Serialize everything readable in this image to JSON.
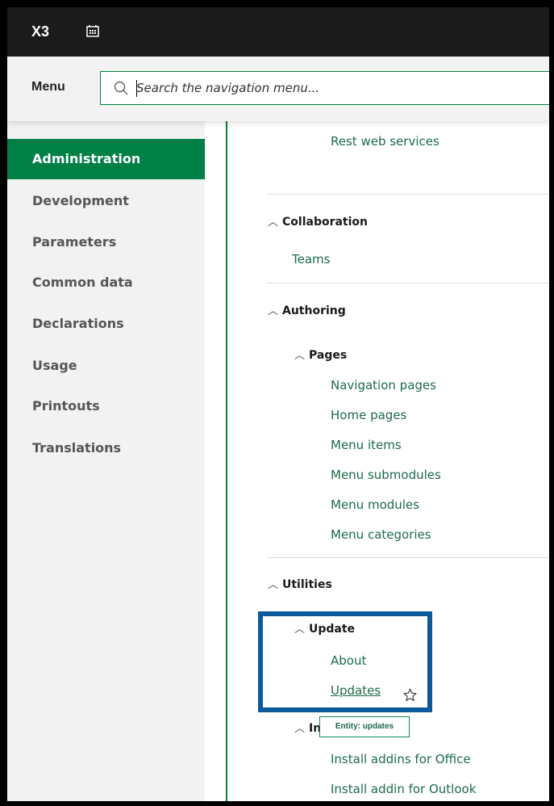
{
  "app": {
    "name": "X3",
    "calendar_icon": "calendar-icon"
  },
  "menubar": {
    "label": "Menu",
    "search_placeholder": "Search the navigation menu...",
    "search_icon": "search-icon"
  },
  "sidebar": {
    "items": [
      {
        "label": "Administration",
        "active": true
      },
      {
        "label": "Development"
      },
      {
        "label": "Parameters"
      },
      {
        "label": "Common data"
      },
      {
        "label": "Declarations"
      },
      {
        "label": "Usage"
      },
      {
        "label": "Printouts"
      },
      {
        "label": "Translations"
      }
    ]
  },
  "content": {
    "top_link": "Rest web services",
    "collaboration": {
      "title": "Collaboration",
      "links": [
        "Teams"
      ]
    },
    "authoring": {
      "title": "Authoring",
      "pages": {
        "title": "Pages",
        "links": [
          "Navigation pages",
          "Home pages",
          "Menu items",
          "Menu submodules",
          "Menu modules",
          "Menu categories"
        ]
      }
    },
    "utilities": {
      "title": "Utilities",
      "update": {
        "title": "Update",
        "links": [
          "About",
          "Updates"
        ]
      },
      "install": {
        "title": "Ins",
        "links": [
          "Install addins for Office",
          "Install addin for Outlook"
        ]
      }
    },
    "tooltip": "Entity: updates"
  },
  "colors": {
    "accent": "#008046",
    "highlight": "#0a5a9c",
    "link": "#1c6b4a"
  }
}
